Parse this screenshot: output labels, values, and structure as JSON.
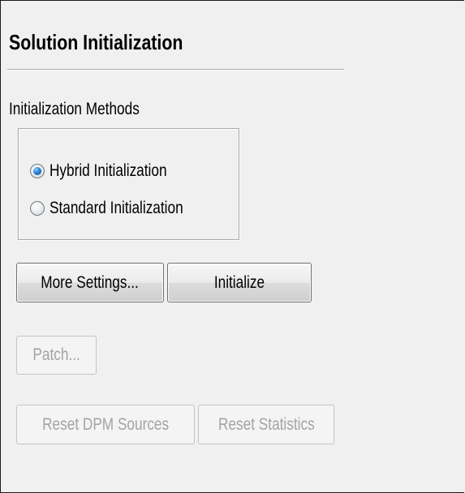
{
  "panel": {
    "title": "Solution Initialization"
  },
  "initialization_methods": {
    "label": "Initialization Methods",
    "options": [
      {
        "label": "Hybrid  Initialization",
        "selected": true
      },
      {
        "label": "Standard Initialization",
        "selected": false
      }
    ]
  },
  "buttons": {
    "more_settings": "More Settings...",
    "initialize": "Initialize",
    "patch": "Patch...",
    "reset_dpm_sources": "Reset DPM Sources",
    "reset_statistics": "Reset Statistics"
  },
  "states": {
    "patch_enabled": false,
    "reset_dpm_sources_enabled": false,
    "reset_statistics_enabled": false
  }
}
